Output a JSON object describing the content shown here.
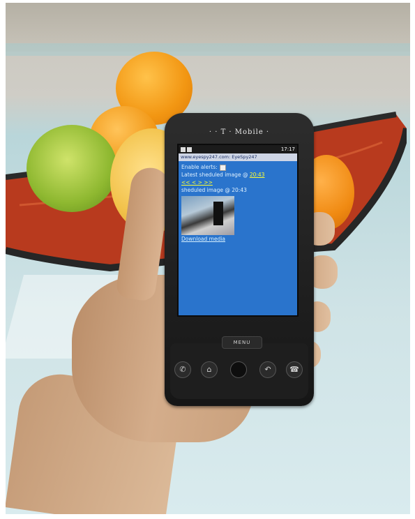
{
  "phone": {
    "brand": "· · T · Mobile ·",
    "status_time": "17:17",
    "url_bar": "www.eyespy247.com: EyeSpy247",
    "content": {
      "enable_alerts_label": "Enable alerts:",
      "latest_label": "Latest sheduled image @",
      "latest_time_link": "20:43",
      "nav_links": "<<  <  >  >>",
      "image_caption": "sheduled image @ 20:43",
      "download_link": "Download media"
    },
    "menu_label": "MENU"
  },
  "icons": [
    "call-icon",
    "home-icon",
    "trackball-icon",
    "back-icon",
    "end-call-icon"
  ],
  "colors": {
    "screen_bg": "#2a74cc",
    "link": "#ffff33",
    "phone_body": "#1e1e1e"
  }
}
